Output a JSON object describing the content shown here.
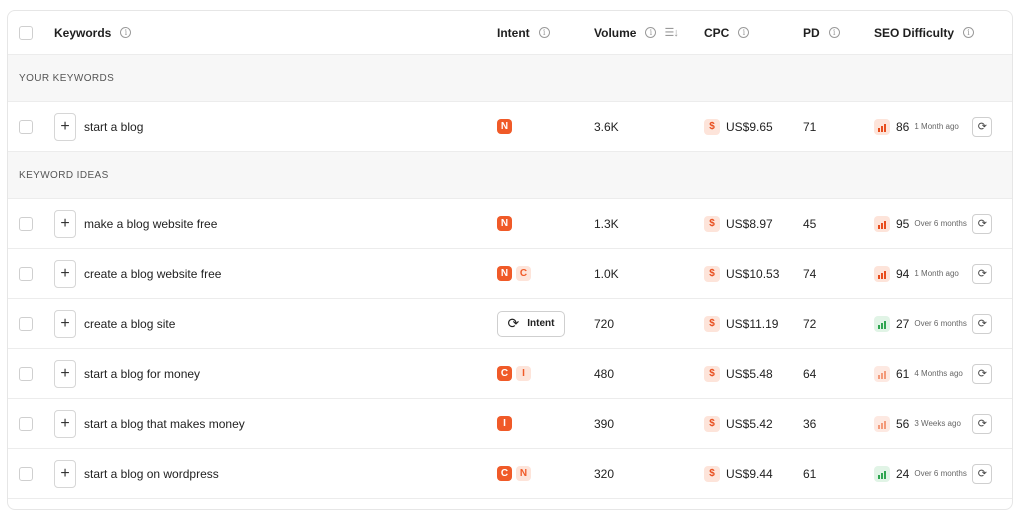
{
  "header": {
    "keywords": "Keywords",
    "intent": "Intent",
    "volume": "Volume",
    "cpc": "CPC",
    "pd": "PD",
    "seo_difficulty": "SEO Difficulty"
  },
  "sections": {
    "your_keywords": "YOUR KEYWORDS",
    "keyword_ideas": "KEYWORD IDEAS"
  },
  "rows": [
    {
      "keyword": "start a blog",
      "intent": [
        "N"
      ],
      "volume": "3.6K",
      "cpc": "US$9.65",
      "pd": "71",
      "difficulty": "86",
      "updated": "1 Month ago"
    },
    {
      "keyword": "make a blog website free",
      "intent": [
        "N"
      ],
      "volume": "1.3K",
      "cpc": "US$8.97",
      "pd": "45",
      "difficulty": "95",
      "updated": "Over 6 months"
    },
    {
      "keyword": "create a blog website free",
      "intent": [
        "N",
        "C"
      ],
      "volume": "1.0K",
      "cpc": "US$10.53",
      "pd": "74",
      "difficulty": "94",
      "updated": "1 Month ago"
    },
    {
      "keyword": "create a blog site",
      "intent_button": "Intent",
      "volume": "720",
      "cpc": "US$11.19",
      "pd": "72",
      "difficulty": "27",
      "updated": "Over 6 months"
    },
    {
      "keyword": "start a blog for money",
      "intent": [
        "C",
        "I"
      ],
      "volume": "480",
      "cpc": "US$5.48",
      "pd": "64",
      "difficulty": "61",
      "updated": "4 Months ago"
    },
    {
      "keyword": "start a blog that makes money",
      "intent": [
        "I"
      ],
      "volume": "390",
      "cpc": "US$5.42",
      "pd": "36",
      "difficulty": "56",
      "updated": "3 Weeks ago"
    },
    {
      "keyword": "start a blog on wordpress",
      "intent": [
        "C",
        "N"
      ],
      "volume": "320",
      "cpc": "US$9.44",
      "pd": "61",
      "difficulty": "24",
      "updated": "Over 6 months"
    }
  ],
  "icons": {
    "info": "info-icon",
    "sort": "sort-icon",
    "add": "plus-icon",
    "refresh": "refresh-icon",
    "cpc": "dollar-icon",
    "difficulty": "bar-chart-icon",
    "intent_button": "sync-icon"
  },
  "colors": {
    "accent": "#f05a28",
    "accent_light": "#fde4da",
    "difficulty_high": "#e84c1c",
    "difficulty_medium": "#f39a7a",
    "difficulty_low": "#2ea650"
  }
}
